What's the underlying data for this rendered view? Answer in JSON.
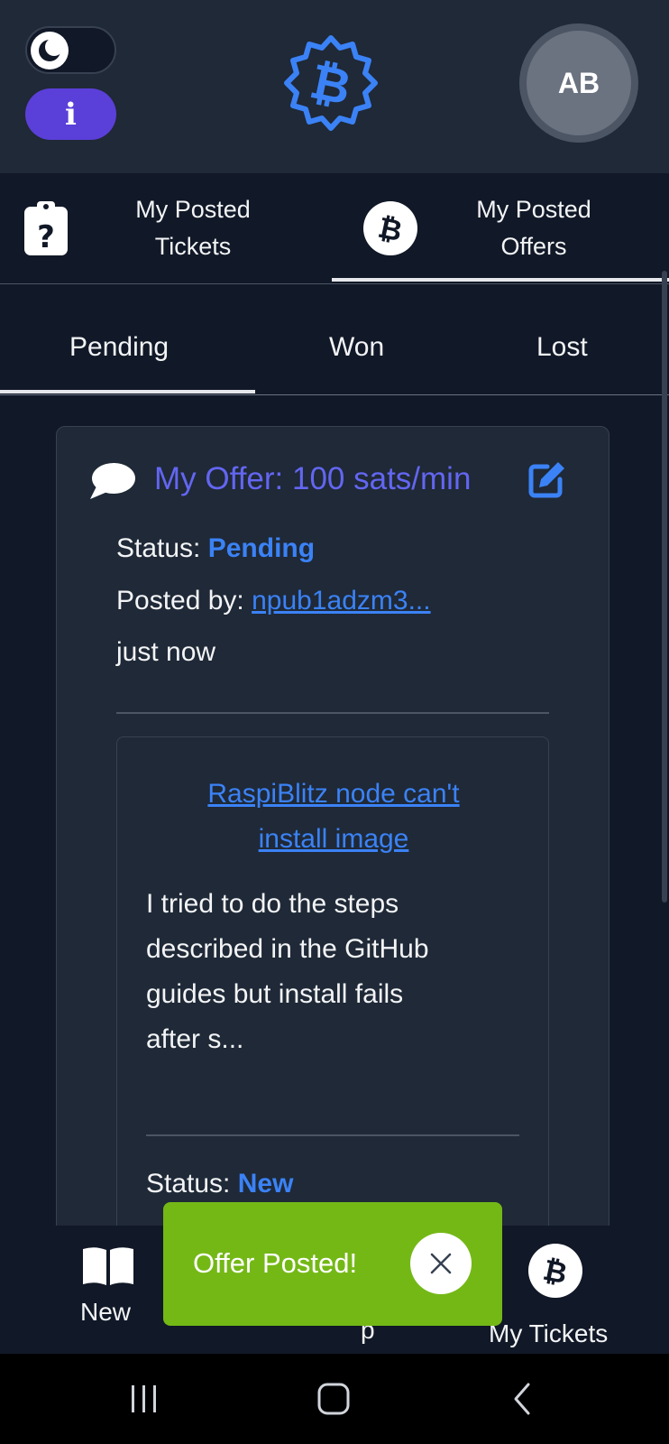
{
  "header": {
    "avatar_initials": "AB",
    "info_label": "i",
    "brand_color": "#3b82f6"
  },
  "main_tabs": [
    {
      "label": "My Posted Tickets",
      "icon": "question-clipboard-icon",
      "active": false
    },
    {
      "label": "My Posted Offers",
      "icon": "bitcoin-icon",
      "active": true
    }
  ],
  "sub_tabs": [
    {
      "label": "Pending",
      "active": true
    },
    {
      "label": "Won",
      "active": false
    },
    {
      "label": "Lost",
      "active": false
    }
  ],
  "offer": {
    "title": "My Offer: 100 sats/min",
    "status_label": "Status:",
    "status_value": "Pending",
    "posted_by_label": "Posted by:",
    "posted_by_value": "npub1adzm3...",
    "time": "just now"
  },
  "ticket": {
    "title": "RaspiBlitz node can't install image",
    "description": "I tried to do the steps described in the GitHub guides but install fails after s...",
    "status_label": "Status:",
    "status_value": "New"
  },
  "bottom_nav": {
    "new_label": "New",
    "middle_label_partial": "p",
    "my_tickets_label": "My Tickets"
  },
  "toast": {
    "message": "Offer Posted!",
    "color": "#74b816"
  }
}
